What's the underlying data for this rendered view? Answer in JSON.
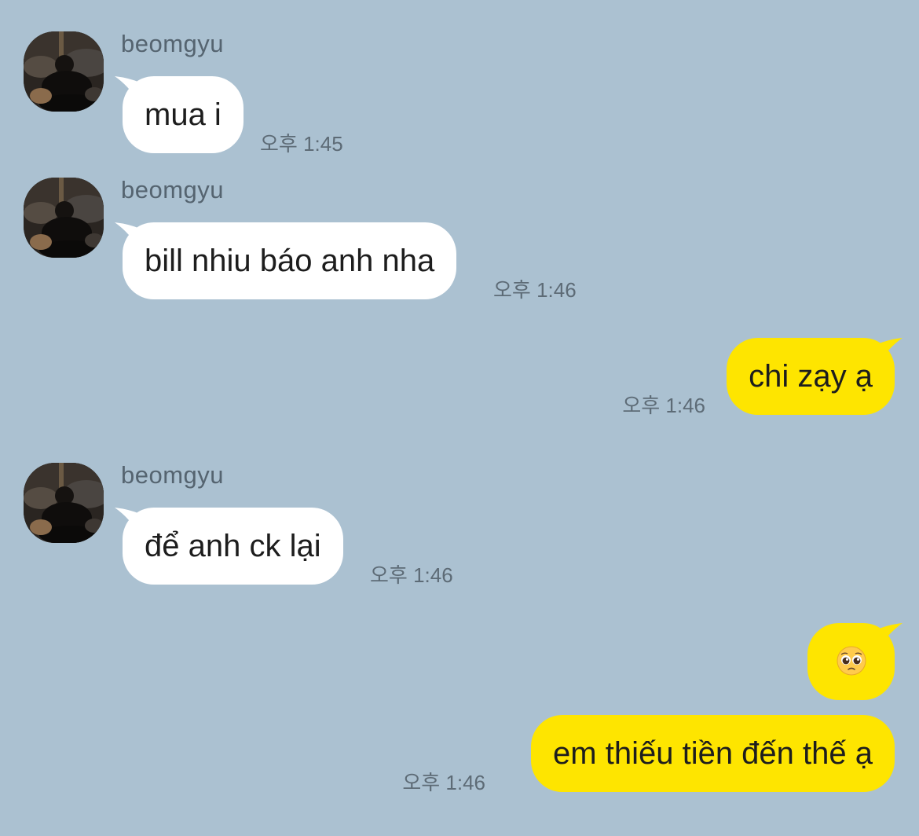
{
  "chat": {
    "messages": [
      {
        "sender": "beomgyu",
        "text": "mua i",
        "time": "오후 1:45",
        "direction": "incoming"
      },
      {
        "sender": "beomgyu",
        "text": "bill nhiu báo anh nha",
        "time": "오후 1:46",
        "direction": "incoming"
      },
      {
        "text": "chi zạy ạ",
        "time": "오후 1:46",
        "direction": "outgoing"
      },
      {
        "sender": "beomgyu",
        "text": "để anh ck lại",
        "time": "오후 1:46",
        "direction": "incoming"
      },
      {
        "text_icon": "pleading-face-emoji",
        "direction": "outgoing"
      },
      {
        "text": "em thiếu tiền đến thế ạ",
        "time": "오후 1:46",
        "direction": "outgoing"
      }
    ]
  },
  "colors": {
    "background": "#abc1d1",
    "incoming_bubble": "#ffffff",
    "outgoing_bubble": "#fee500",
    "timestamp": "#5d6b76",
    "sender_name": "#556470"
  }
}
